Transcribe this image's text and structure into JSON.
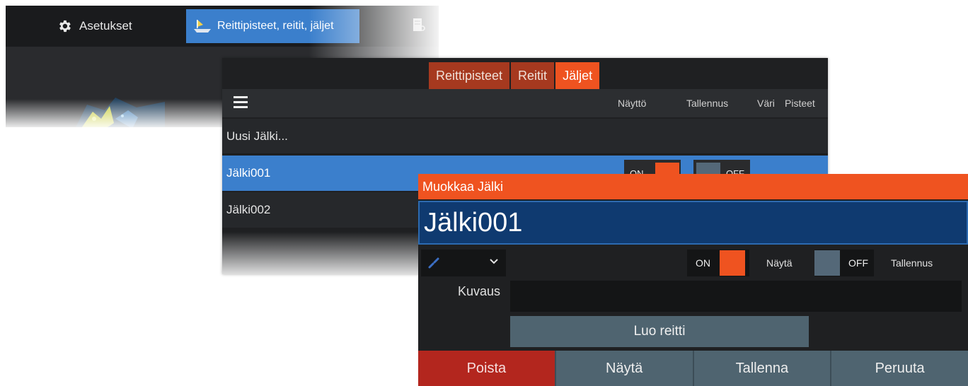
{
  "topbar": {
    "settings_label": "Asetukset",
    "waypoints_label": "Reittipisteet, reitit, jäljet",
    "settings_icon": "gear-icon",
    "waypoints_icon": "waypoint-boat-icon"
  },
  "list": {
    "tabs": [
      {
        "label": "Reittipisteet",
        "active": false
      },
      {
        "label": "Reitit",
        "active": false
      },
      {
        "label": "Jäljet",
        "active": true
      }
    ],
    "columns": {
      "display": "Näyttö",
      "record": "Tallennus",
      "color": "Väri",
      "points": "Pisteet"
    },
    "new_item": "Uusi Jälki...",
    "items": [
      {
        "name": "Jälki001",
        "selected": true,
        "display_state": "ON",
        "record_state": "OFF"
      },
      {
        "name": "Jälki002",
        "selected": false
      }
    ]
  },
  "dialog": {
    "title": "Muokkaa Jälki",
    "name_value": "Jälki001",
    "color_icon": "chain-link-icon",
    "show_toggle": {
      "state": "ON",
      "label": "Näytä"
    },
    "record_toggle": {
      "state": "OFF",
      "label": "Tallennus"
    },
    "description_label": "Kuvaus",
    "description_value": "",
    "create_route_label": "Luo reitti",
    "buttons": {
      "delete": "Poista",
      "show": "Näytä",
      "save": "Tallenna",
      "cancel": "Peruuta"
    }
  },
  "colors": {
    "accent_orange": "#ef5320",
    "selection_blue": "#3b7fcc",
    "tab_inactive": "#a6391f",
    "danger_red": "#b3261e",
    "button_gray": "#4f6470",
    "name_field_blue": "#0f3a70"
  }
}
